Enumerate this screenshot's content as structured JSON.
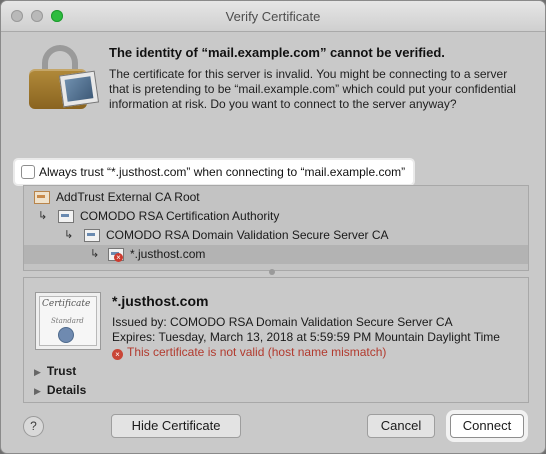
{
  "window": {
    "title": "Verify Certificate"
  },
  "message": {
    "title": "The identity of “mail.example.com” cannot be verified.",
    "body": "The certificate for this server is invalid. You might be connecting to a server that is pretending to be “mail.example.com” which could put your confidential information at risk. Do you want to connect to the server anyway?"
  },
  "trust_checkbox": {
    "label": "Always trust “*.justhost.com” when connecting to “mail.example.com”",
    "checked": false
  },
  "chain": [
    {
      "label": "AddTrust External CA Root",
      "icon": "certificate-icon"
    },
    {
      "label": "COMODO RSA Certification Authority",
      "icon": "certificate-icon"
    },
    {
      "label": "COMODO RSA Domain Validation Secure Server CA",
      "icon": "certificate-icon"
    },
    {
      "label": "*.justhost.com",
      "icon": "certificate-invalid-icon",
      "selected": true
    }
  ],
  "details": {
    "certificate_word": "Certificate",
    "certificate_subword": "Standard",
    "name": "*.justhost.com",
    "issued_by": "Issued by: COMODO RSA Domain Validation Secure Server CA",
    "expires": "Expires: Tuesday, March 13, 2018 at 5:59:59 PM Mountain Daylight Time",
    "error": "This certificate is not valid (host name mismatch)",
    "sections": [
      {
        "label": "Trust"
      },
      {
        "label": "Details"
      }
    ]
  },
  "buttons": {
    "help": "?",
    "hide_certificate": "Hide Certificate",
    "cancel": "Cancel",
    "connect": "Connect"
  },
  "colors": {
    "error": "#b23a2e",
    "zoom_button": "#2dbc3f"
  }
}
